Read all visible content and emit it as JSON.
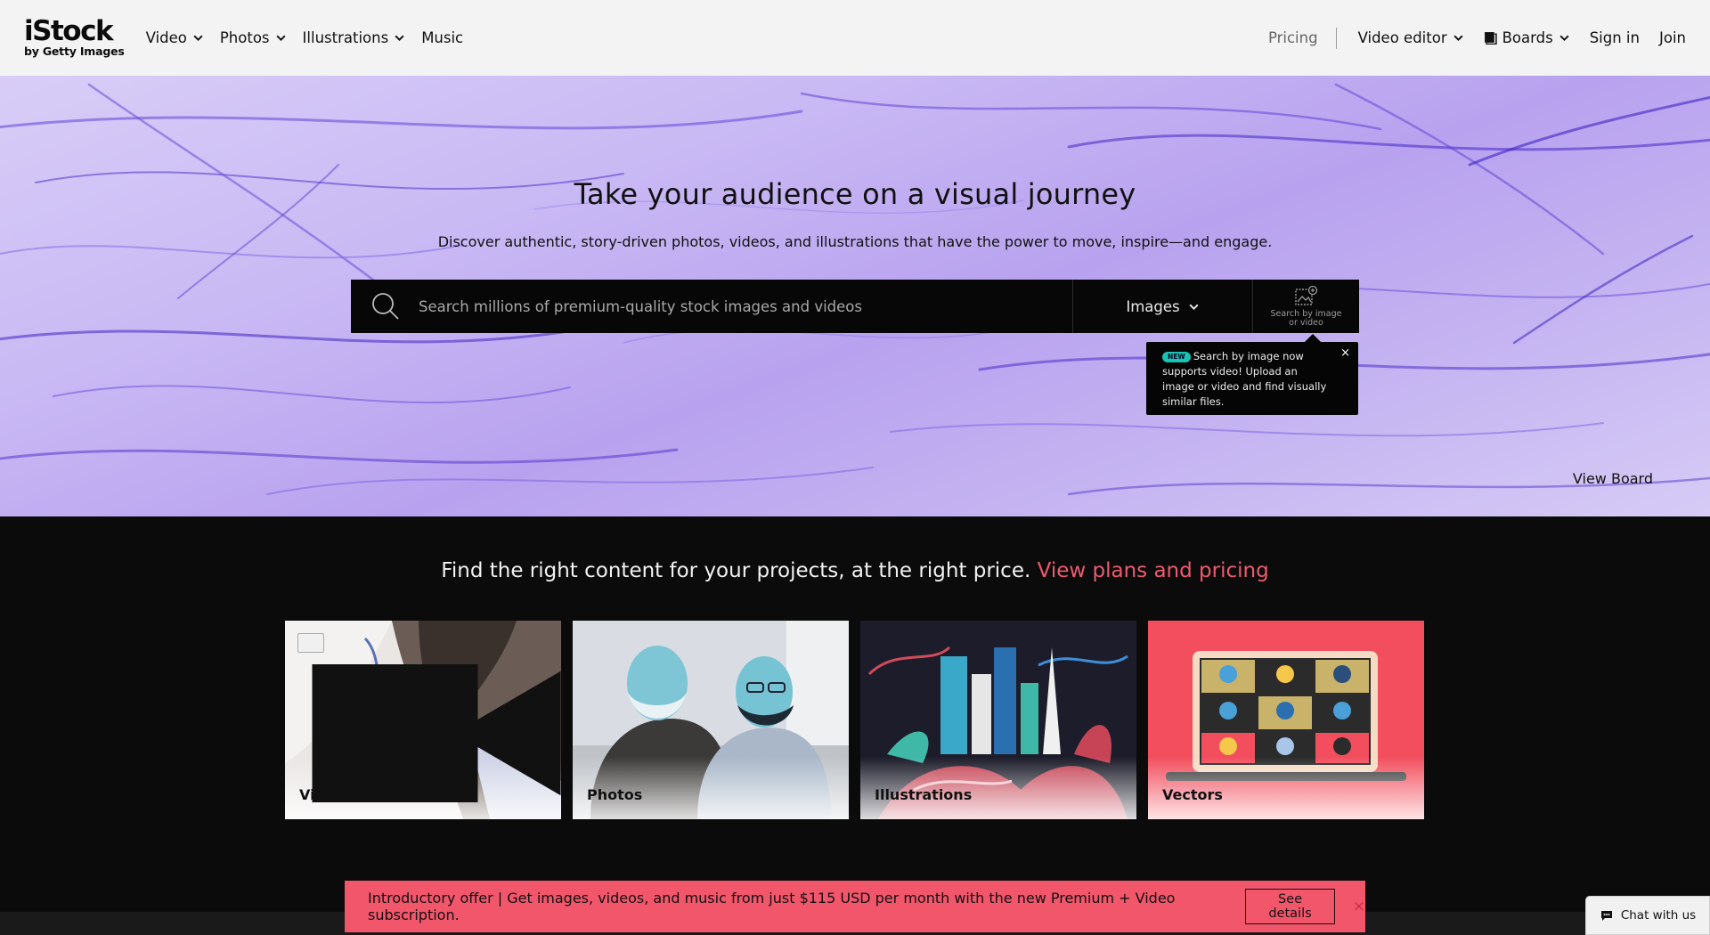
{
  "header": {
    "logo_brand": "iStock",
    "logo_sub": "by Getty Images",
    "nav_left": [
      {
        "label": "Video",
        "dropdown": true
      },
      {
        "label": "Photos",
        "dropdown": true
      },
      {
        "label": "Illustrations",
        "dropdown": true
      },
      {
        "label": "Music",
        "dropdown": false
      }
    ],
    "pricing": "Pricing",
    "video_editor": "Video editor",
    "boards": "Boards",
    "sign_in": "Sign in",
    "join": "Join"
  },
  "hero": {
    "title": "Take your audience on a visual journey",
    "subtitle": "Discover authentic, story-driven photos, videos, and illustrations that have the power to move, inspire—and engage.",
    "search_placeholder": "Search millions of premium-quality stock images and videos",
    "search_type": "Images",
    "image_search_label_1": "Search by image",
    "image_search_label_2": "or video",
    "tooltip_badge": "NEW",
    "tooltip_text": "Search by image now supports video! Upload an image or video and find visually similar files.",
    "tooltip_close": "×",
    "view_board": "View Board"
  },
  "pitch": {
    "text": "Find the right content for your projects, at the right price.",
    "link": "View plans and pricing"
  },
  "cards": [
    {
      "label": "Video"
    },
    {
      "label": "Photos"
    },
    {
      "label": "Illustrations"
    },
    {
      "label": "Vectors"
    }
  ],
  "promo": {
    "text": "Introductory offer | Get images, videos, and music from just $115 USD per month with the new Premium + Video subscription.",
    "button": "See details",
    "close": "×"
  },
  "chat": {
    "label": "Chat with us"
  },
  "colors": {
    "accent_link": "#ef5a6f",
    "promo_bg": "#f2566b",
    "header_bg": "#f4f3f3",
    "dark_bg": "#0b0b0b",
    "badge": "#18c4b3"
  }
}
